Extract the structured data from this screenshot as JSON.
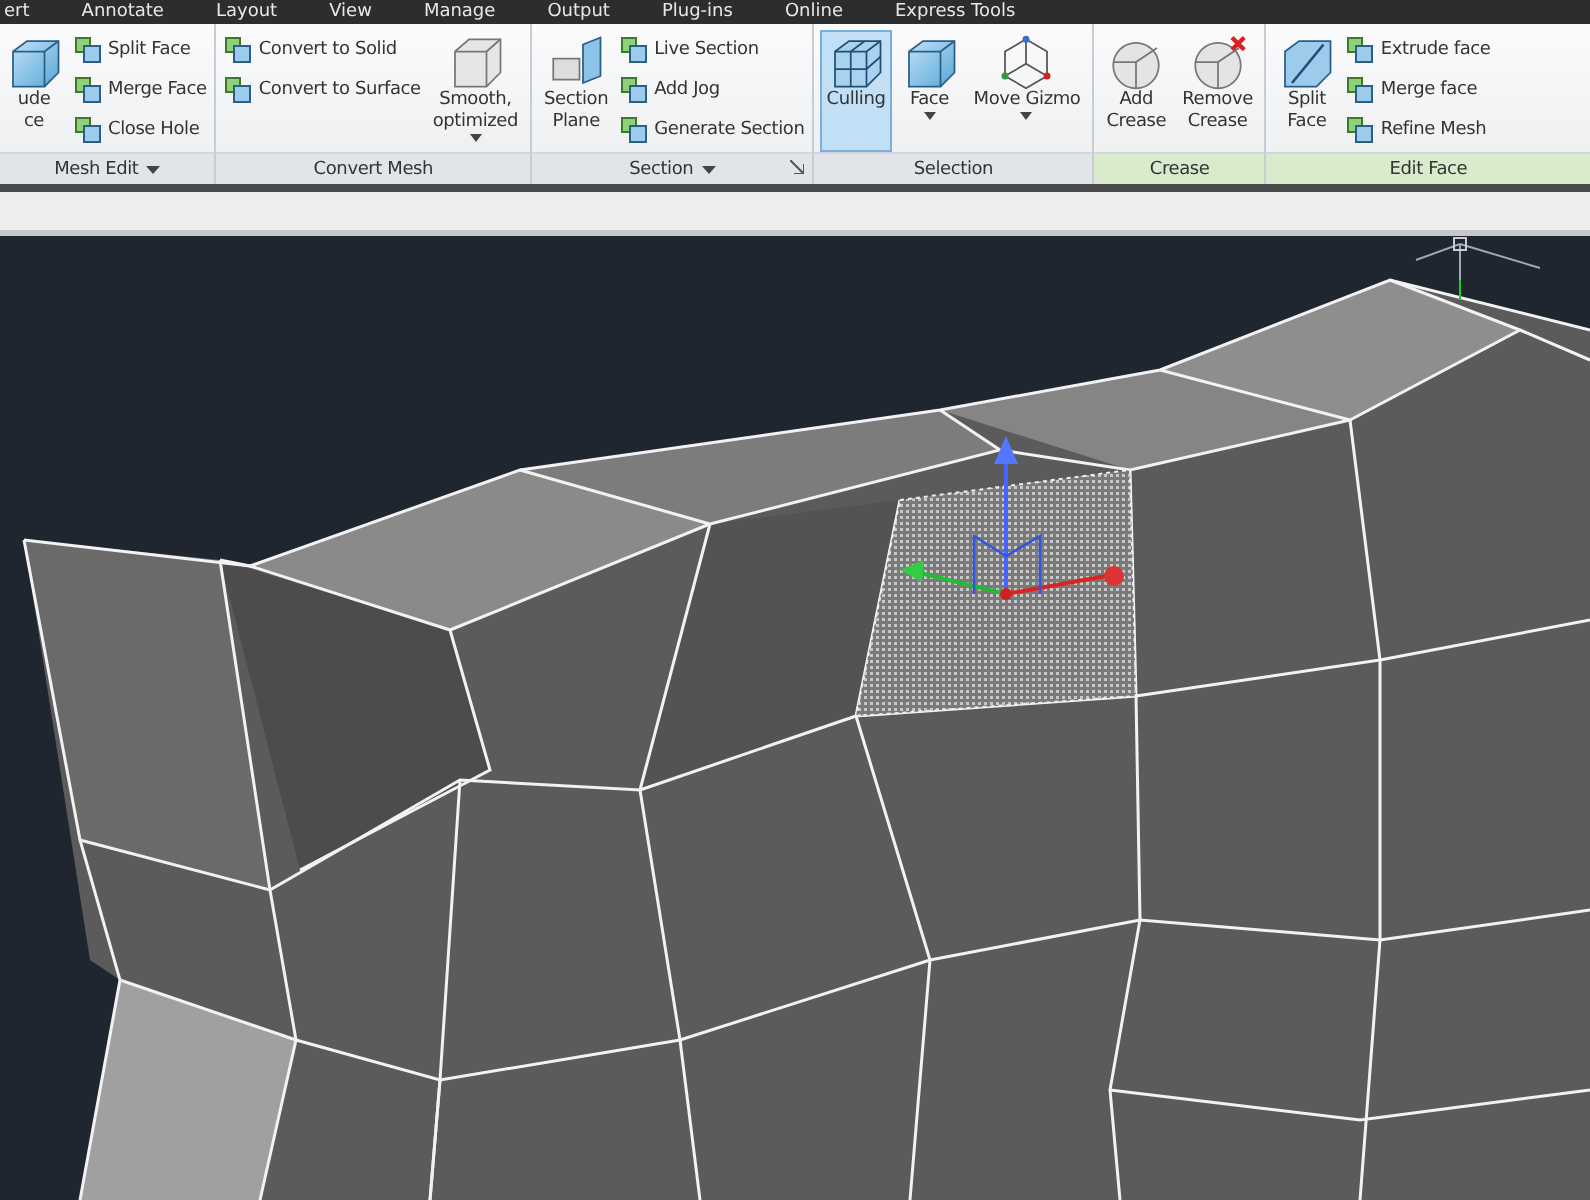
{
  "tabs": [
    "ert",
    "Annotate",
    "Layout",
    "View",
    "Manage",
    "Output",
    "Plug-ins",
    "Online",
    "Express Tools"
  ],
  "panels": [
    {
      "title": "Mesh Edit",
      "menu": true,
      "launcher": false,
      "highlight": false,
      "items": [
        {
          "kind": "large",
          "lines": [
            "ude",
            "ce"
          ],
          "selected": false,
          "dropdown": false
        },
        {
          "kind": "small",
          "label": "Split Face"
        },
        {
          "kind": "small",
          "label": "Merge Face"
        },
        {
          "kind": "small",
          "label": "Close Hole"
        }
      ]
    },
    {
      "title": "Convert Mesh",
      "menu": false,
      "launcher": false,
      "highlight": false,
      "items": [
        {
          "kind": "small",
          "label": "Convert to Solid"
        },
        {
          "kind": "small",
          "label": "Convert to Surface"
        },
        {
          "kind": "large",
          "lines": [
            "Smooth,",
            "optimized"
          ],
          "selected": false,
          "dropdown": true
        }
      ]
    },
    {
      "title": "Section",
      "menu": true,
      "launcher": true,
      "highlight": false,
      "items": [
        {
          "kind": "large",
          "lines": [
            "Section",
            "Plane"
          ],
          "selected": false,
          "dropdown": false
        },
        {
          "kind": "small",
          "label": "Live Section"
        },
        {
          "kind": "small",
          "label": "Add Jog"
        },
        {
          "kind": "small",
          "label": "Generate Section"
        }
      ]
    },
    {
      "title": "Selection",
      "menu": false,
      "launcher": false,
      "highlight": false,
      "items": [
        {
          "kind": "large",
          "lines": [
            "Culling"
          ],
          "selected": true,
          "dropdown": false
        },
        {
          "kind": "large",
          "lines": [
            "Face"
          ],
          "selected": false,
          "dropdown": true
        },
        {
          "kind": "large",
          "lines": [
            "Move Gizmo"
          ],
          "selected": false,
          "dropdown": true
        }
      ]
    },
    {
      "title": "Crease",
      "menu": false,
      "launcher": false,
      "highlight": true,
      "items": [
        {
          "kind": "large",
          "lines": [
            "Add",
            "Crease"
          ],
          "selected": false,
          "dropdown": false
        },
        {
          "kind": "large",
          "lines": [
            "Remove",
            "Crease"
          ],
          "selected": false,
          "dropdown": false
        }
      ]
    },
    {
      "title": "Edit Face",
      "menu": false,
      "launcher": false,
      "highlight": true,
      "items": [
        {
          "kind": "large",
          "lines": [
            "Split",
            "Face"
          ],
          "selected": false,
          "dropdown": false
        },
        {
          "kind": "small",
          "label": "Extrude face"
        },
        {
          "kind": "small",
          "label": "Merge face"
        },
        {
          "kind": "small",
          "label": "Refine Mesh"
        }
      ]
    }
  ]
}
